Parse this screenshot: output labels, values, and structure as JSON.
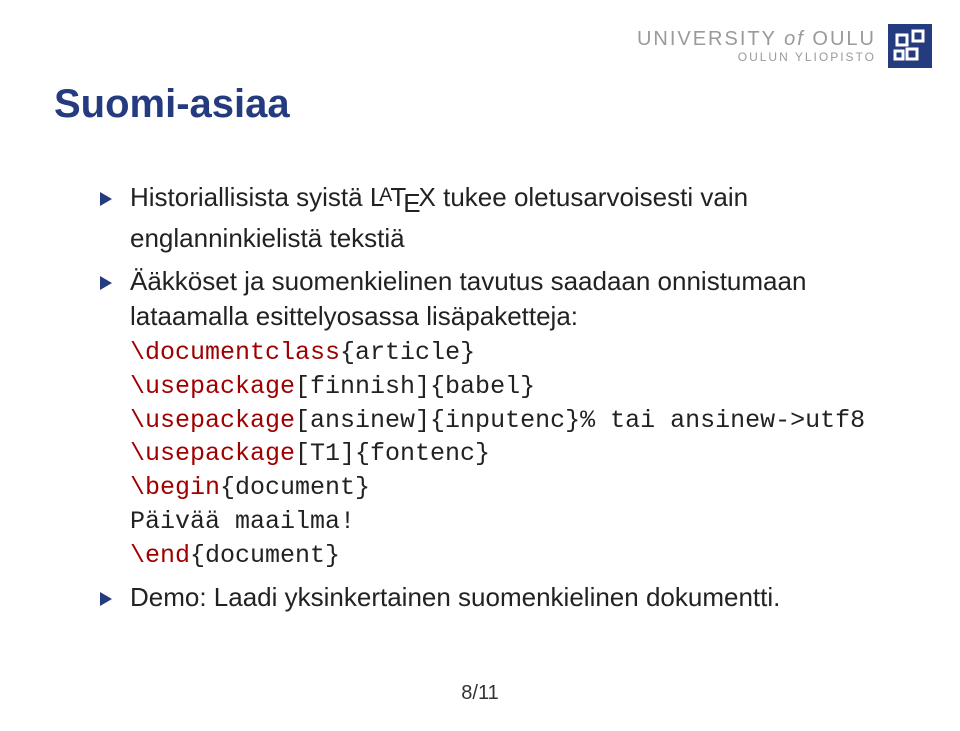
{
  "header": {
    "university_main_pre": "UNIVERSITY",
    "university_main_of": "of",
    "university_main_post": "OULU",
    "university_sub": "OULUN YLIOPISTO"
  },
  "title": "Suomi-asiaa",
  "items": {
    "a_pre": "Historiallisista syistä ",
    "a_post": " tukee oletusarvoisesti vain englanninkielistä tekstiä",
    "b": "Ääkköset ja suomenkielinen tavutus saadaan onnistumaan lataamalla esittelyosassa lisäpaketteja:",
    "c": "Demo: Laadi yksinkertainen suomenkielinen dokumentti."
  },
  "code": {
    "l1_cmd": "\\documentclass",
    "l1_arg": "{article}",
    "l2_cmd": "\\usepackage",
    "l2_arg": "[finnish]{babel}",
    "l3_cmd": "\\usepackage",
    "l3_arg": "[ansinew]{inputenc}",
    "l3_comment": "% tai ansinew->utf8",
    "l4_cmd": "\\usepackage",
    "l4_arg": "[T1]{fontenc}",
    "l5_cmd": "\\begin",
    "l5_arg": "{document}",
    "l6": "Päivää maailma!",
    "l7_cmd": "\\end",
    "l7_arg": "{document}"
  },
  "pagenum": "8/11"
}
